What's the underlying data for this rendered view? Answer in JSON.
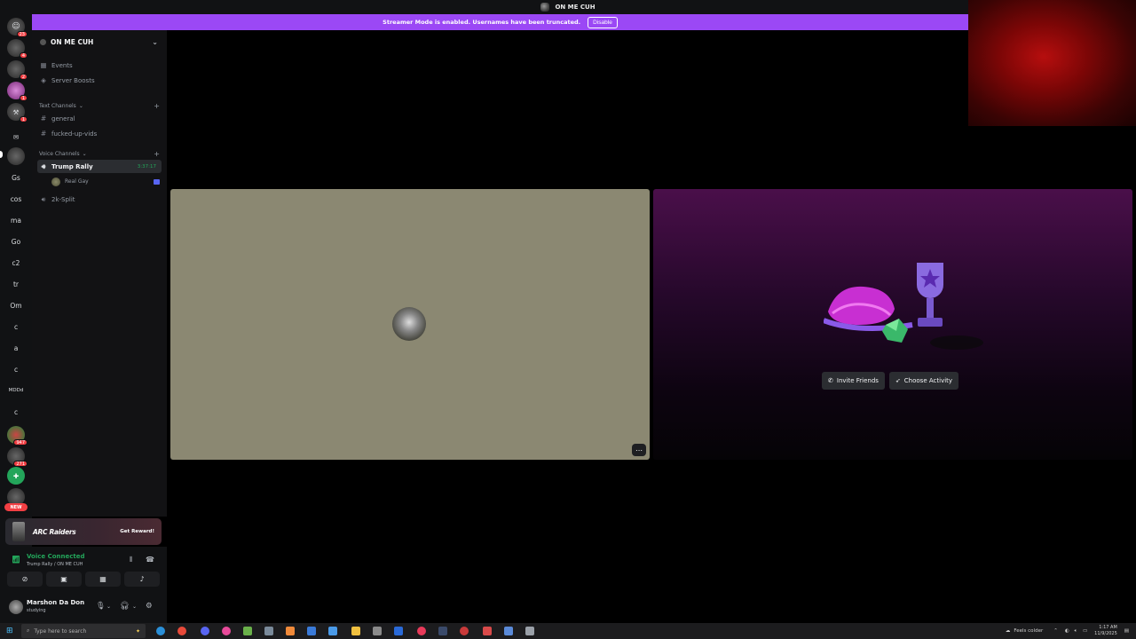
{
  "window": {
    "title": "ON ME CUH"
  },
  "banner": {
    "text": "Streamer Mode is enabled. Usernames have been truncated.",
    "button": "Disable"
  },
  "rail": {
    "badges": [
      "23",
      "4",
      "2",
      "1",
      "1",
      "947",
      "271"
    ],
    "text_servers": [
      "Gs",
      "cos",
      "ma",
      "Go",
      "c2",
      "tr",
      "Om",
      "c",
      "a",
      "c",
      "MDDd",
      "c"
    ],
    "new_label": "NEW"
  },
  "server": {
    "name": "ON ME CUH"
  },
  "nav": {
    "events": "Events",
    "boosts": "Server Boosts"
  },
  "text_category": "Text Channels",
  "text_channels": [
    "general",
    "fucked-up-vids"
  ],
  "voice_category": "Voice Channels",
  "voice_channels": [
    {
      "name": "Trump Rally",
      "timer": "3:37:17",
      "members": [
        "Real Gay"
      ]
    },
    {
      "name": "2k-Split"
    }
  ],
  "promo": {
    "logo": "ARC Raiders",
    "cta": "Get Reward!"
  },
  "voice": {
    "status": "Voice Connected",
    "location": "Trump Rally / ON ME CUH"
  },
  "user": {
    "name": "Marshon Da Don",
    "status": "studying"
  },
  "stage": {
    "invite": "Invite Friends",
    "choose": "Choose Activity"
  },
  "taskbar": {
    "search_placeholder": "Type here to search",
    "weather": "Feels colder",
    "time": "1:17 AM",
    "date": "11/9/2025"
  },
  "colors": {
    "accent": "#9b48f5",
    "online": "#23a55a",
    "blurple": "#5865f2"
  }
}
